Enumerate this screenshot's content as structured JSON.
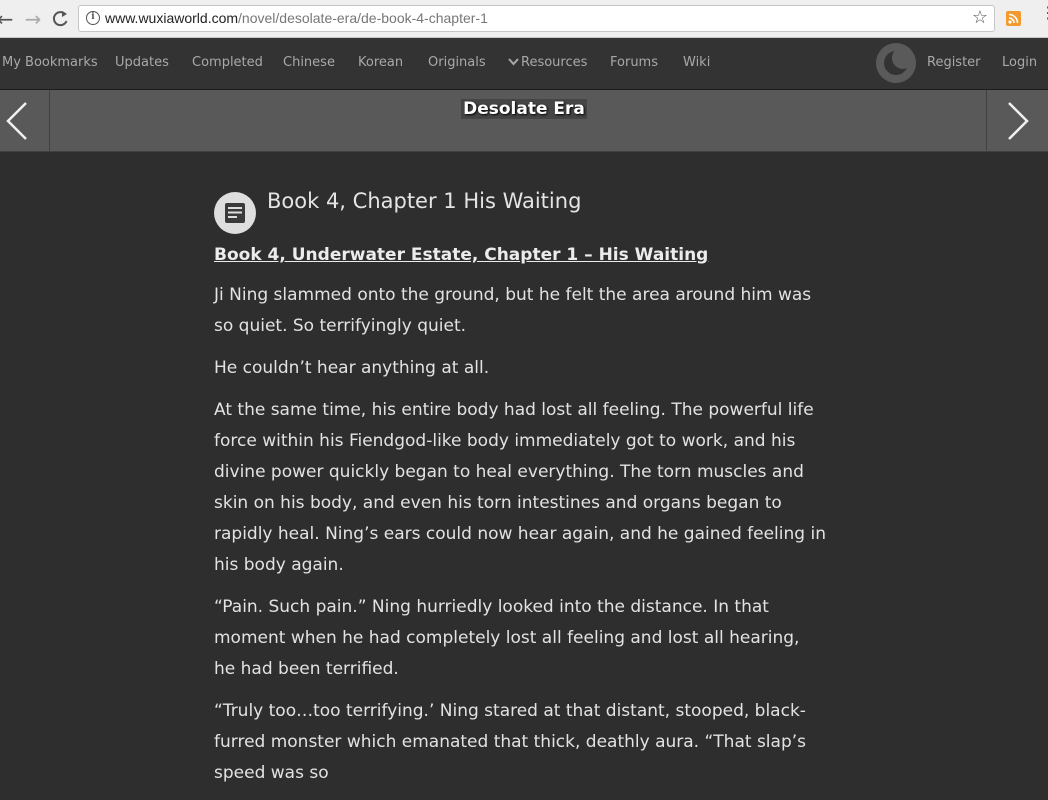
{
  "browser": {
    "url_host": "www.wuxiaworld.com",
    "url_path": "/novel/desolate-era/de-book-4-chapter-1",
    "back_icon": "back-arrow-icon",
    "forward_icon": "forward-arrow-icon",
    "reload_icon": "reload-icon"
  },
  "nav": {
    "items": [
      "My Bookmarks",
      "Updates",
      "Completed",
      "Chinese",
      "Korean",
      "Originals",
      "Resources",
      "Forums",
      "Wiki"
    ],
    "register": "Register",
    "login": "Login"
  },
  "title_bar": {
    "novel_title": "Desolate Era"
  },
  "chapter": {
    "title": "Book 4, Chapter 1 His Waiting",
    "subhead": "Book 4, Underwater Estate, Chapter 1 – His Waiting",
    "paragraphs": [
      "Ji Ning slammed onto the ground, but he felt the area around him was so quiet. So terrifyingly quiet.",
      "He couldn’t hear anything at all.",
      "At the same time, his entire body had lost all feeling. The powerful life force within his Fiendgod-like body immediately got to work, and his divine power quickly began to heal everything. The torn muscles and skin on his body, and even his torn intestines and organs began to rapidly heal. Ning’s ears could now hear again, and he gained feeling in his body again.",
      "“Pain. Such pain.” Ning hurriedly looked into the distance. In that moment when he had completely lost all feeling and lost all hearing, he had been terrified.",
      "“Truly too…too terrifying.’ Ning stared at that distant, stooped, black-furred monster which emanated that thick, deathly aura. “That slap’s speed was so"
    ]
  },
  "colors": {
    "page_bg": "#2e2e2e",
    "nav_bg": "#333333",
    "title_bar_bg": "#595959",
    "text": "#e2e2e2"
  }
}
